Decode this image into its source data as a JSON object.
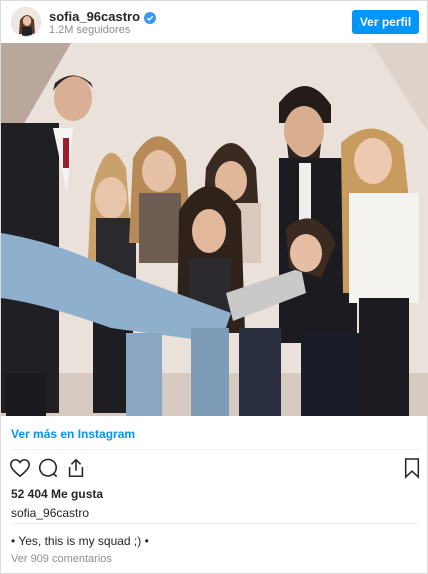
{
  "header": {
    "username": "sofia_96castro",
    "followers": "1.2M seguidores",
    "view_profile_label": "Ver perfil"
  },
  "post": {
    "view_more_label": "Ver más en Instagram",
    "likes": "52 404 Me gusta",
    "caption_username": "sofia_96castro",
    "caption_text": "• Yes, this is my squad ;) •",
    "comments_link": "Ver 909 comentarios"
  },
  "icons": {
    "like": "heart-icon",
    "comment": "comment-icon",
    "share": "share-icon",
    "save": "bookmark-icon",
    "verified": "verified-badge-icon"
  },
  "colors": {
    "accent": "#0095f6",
    "muted": "#8e8e8e",
    "text": "#262626"
  }
}
